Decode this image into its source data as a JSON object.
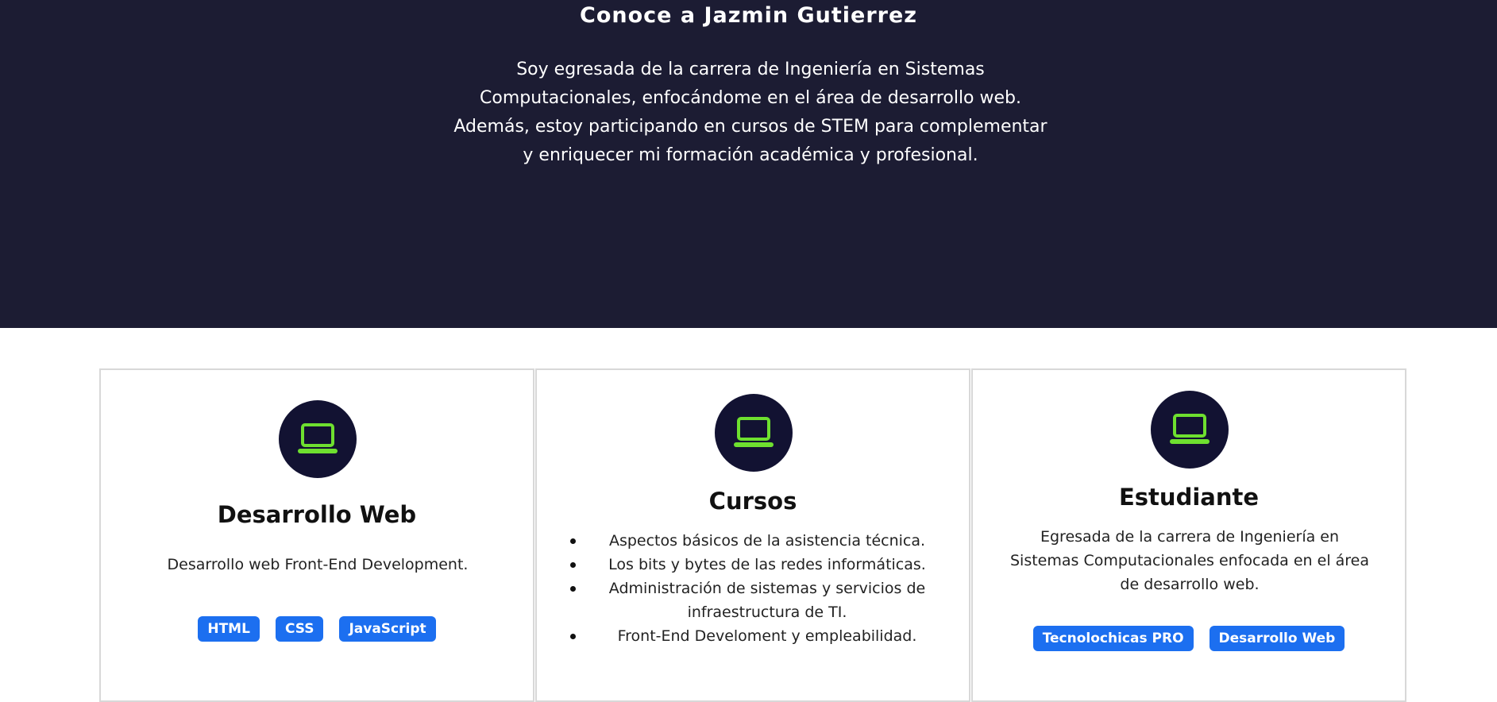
{
  "hero": {
    "title": "Conoce a Jazmin Gutierrez",
    "text": "Soy egresada de la carrera de Ingeniería en Sistemas Computacionales, enfocándome en el área de desarrollo web. Además, estoy participando en cursos de STEM para complementar y enriquecer mi formación académica y profesional.",
    "background_color": "#1c1c33"
  },
  "cards": [
    {
      "icon": "laptop-icon",
      "title": "Desarrollo Web",
      "text": "Desarrollo web Front-End Development.",
      "tags": [
        "HTML",
        "CSS",
        "JavaScript"
      ]
    },
    {
      "icon": "laptop-icon",
      "title": "Cursos",
      "items": [
        "Aspectos básicos de la asistencia técnica.",
        "Los bits y bytes de las redes informáticas.",
        "Administración de sistemas y servicios de infraestructura de TI.",
        "Front-End Develoment y empleabilidad."
      ]
    },
    {
      "icon": "laptop-icon",
      "title": "Estudiante",
      "text": "Egresada de la carrera de Ingeniería en Sistemas Computacionales enfocada en el área de desarrollo web.",
      "tags": [
        "Tecnolochicas PRO",
        "Desarrollo Web"
      ]
    }
  ],
  "colors": {
    "icon_bg": "#121232",
    "icon_fg": "#6ee02f",
    "tag_bg": "#1c6ff0"
  }
}
